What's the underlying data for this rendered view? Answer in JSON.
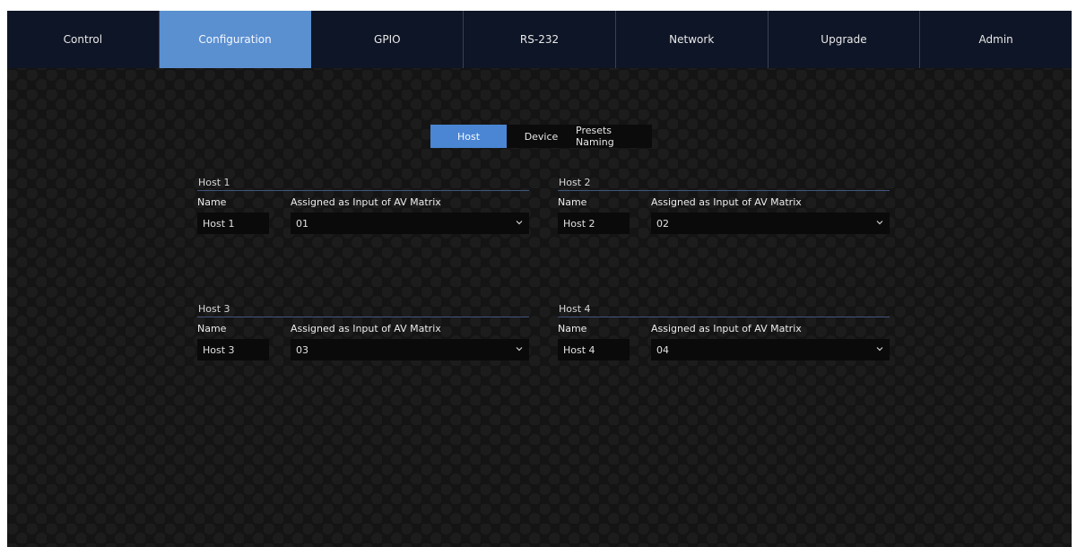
{
  "nav": {
    "tabs": [
      {
        "label": "Control"
      },
      {
        "label": "Configuration"
      },
      {
        "label": "GPIO"
      },
      {
        "label": "RS-232"
      },
      {
        "label": "Network"
      },
      {
        "label": "Upgrade"
      },
      {
        "label": "Admin"
      }
    ],
    "active": "Configuration"
  },
  "subtabs": {
    "host": "Host",
    "device": "Device",
    "presets": "Presets Naming",
    "active": "Host"
  },
  "hosts": [
    {
      "title": "Host 1",
      "name_label": "Name",
      "assign_label": "Assigned as Input of AV Matrix",
      "name_value": "Host 1",
      "assign_value": "01"
    },
    {
      "title": "Host 2",
      "name_label": "Name",
      "assign_label": "Assigned as Input of AV Matrix",
      "name_value": "Host 2",
      "assign_value": "02"
    },
    {
      "title": "Host 3",
      "name_label": "Name",
      "assign_label": "Assigned as Input of AV Matrix",
      "name_value": "Host 3",
      "assign_value": "03"
    },
    {
      "title": "Host 4",
      "name_label": "Name",
      "assign_label": "Assigned as Input of AV Matrix",
      "name_value": "Host 4",
      "assign_value": "04"
    }
  ],
  "colors": {
    "nav_background": "#0e1526",
    "nav_active": "#5a8fd0",
    "subtab_active": "#4a86d4",
    "page_background": "#141414"
  },
  "icons": {
    "dropdown": "chevron-down-icon"
  }
}
